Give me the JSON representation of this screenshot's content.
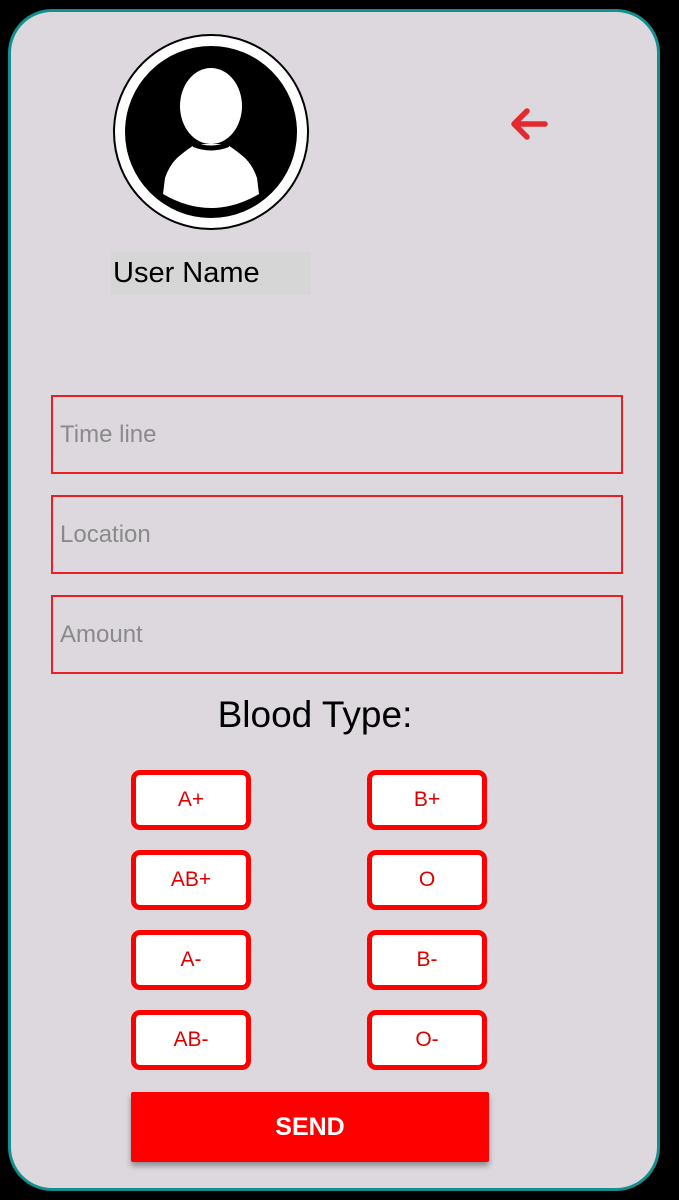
{
  "profile": {
    "username": "User Name",
    "avatar_icon": "user-avatar-icon"
  },
  "header": {
    "back_icon": "arrow-left-icon"
  },
  "form": {
    "timeline_placeholder": "Time line",
    "location_placeholder": "Location",
    "amount_placeholder": "Amount",
    "blood_type_label": "Blood Type:",
    "blood_types": [
      "A+",
      "B+",
      "AB+",
      "O",
      "A-",
      "B-",
      "AB-",
      "O-"
    ],
    "send_label": "SEND"
  },
  "colors": {
    "background": "#dcd8de",
    "frame_border": "#12908f",
    "accent_red": "#ff0000",
    "field_border": "#e81e25",
    "back_arrow": "#e32a2f",
    "placeholder_gray": "#8a8a8a"
  }
}
